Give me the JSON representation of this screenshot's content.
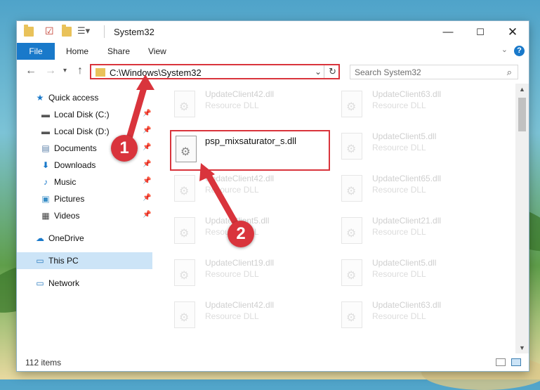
{
  "window": {
    "title": "System32"
  },
  "ribbon": {
    "file": "File",
    "home": "Home",
    "share": "Share",
    "view": "View",
    "help": "?"
  },
  "address": {
    "path": "C:\\Windows\\System32"
  },
  "search": {
    "placeholder": "Search System32"
  },
  "sidebar": {
    "items": [
      {
        "label": "Quick access",
        "icon": "star-icon"
      },
      {
        "label": "Local Disk (C:)",
        "icon": "drive-icon",
        "pinned": true
      },
      {
        "label": "Local Disk (D:)",
        "icon": "drive-icon",
        "pinned": true
      },
      {
        "label": "Documents",
        "icon": "documents-icon",
        "pinned": true
      },
      {
        "label": "Downloads",
        "icon": "download-icon",
        "pinned": true
      },
      {
        "label": "Music",
        "icon": "music-icon",
        "pinned": true
      },
      {
        "label": "Pictures",
        "icon": "pictures-icon",
        "pinned": true
      },
      {
        "label": "Videos",
        "icon": "videos-icon",
        "pinned": true
      },
      {
        "label": "OneDrive",
        "icon": "cloud-icon"
      },
      {
        "label": "This PC",
        "icon": "computer-icon",
        "selected": true
      },
      {
        "label": "Network",
        "icon": "network-icon"
      }
    ]
  },
  "files": [
    {
      "name": "UpdateClient42.dll",
      "type": "Resource DLL"
    },
    {
      "name": "UpdateClient63.dll",
      "type": "Resource DLL"
    },
    {
      "name": "psp_mixsaturator_s.dll",
      "type": ""
    },
    {
      "name": "UpdateClient5.dll",
      "type": "Resource DLL"
    },
    {
      "name": "UpdateClient42.dll",
      "type": "Resource DLL"
    },
    {
      "name": "UpdateClient65.dll",
      "type": "Resource DLL"
    },
    {
      "name": "UpdateClient5.dll",
      "type": "Resource DLL"
    },
    {
      "name": "UpdateClient21.dll",
      "type": "Resource DLL"
    },
    {
      "name": "UpdateClient19.dll",
      "type": "Resource DLL"
    },
    {
      "name": "UpdateClient5.dll",
      "type": "Resource DLL"
    },
    {
      "name": "UpdateClient42.dll",
      "type": "Resource DLL"
    },
    {
      "name": "UpdateClient63.dll",
      "type": "Resource DLL"
    }
  ],
  "status": {
    "items": "112 items"
  },
  "callouts": {
    "one": "1",
    "two": "2"
  },
  "colors": {
    "accent": "#1979ca",
    "highlight": "#d9343c",
    "selected": "#cce4f7"
  }
}
